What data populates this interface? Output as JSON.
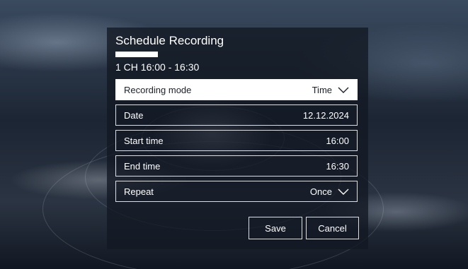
{
  "dialog": {
    "title": "Schedule Recording",
    "subtitle": "1 CH 16:00 - 16:30"
  },
  "fields": [
    {
      "label": "Recording mode",
      "value": "Time",
      "icon": "chevron-down-icon",
      "selected": true
    },
    {
      "label": "Date",
      "value": "12.12.2024"
    },
    {
      "label": "Start time",
      "value": "16:00"
    },
    {
      "label": "End time",
      "value": "16:30"
    },
    {
      "label": "Repeat",
      "value": "Once",
      "icon": "chevron-down-icon"
    }
  ],
  "buttons": {
    "save": "Save",
    "cancel": "Cancel"
  },
  "colors": {
    "selected_background": "#ffffff",
    "text": "#ffffff",
    "dialog_background": "#121822"
  }
}
